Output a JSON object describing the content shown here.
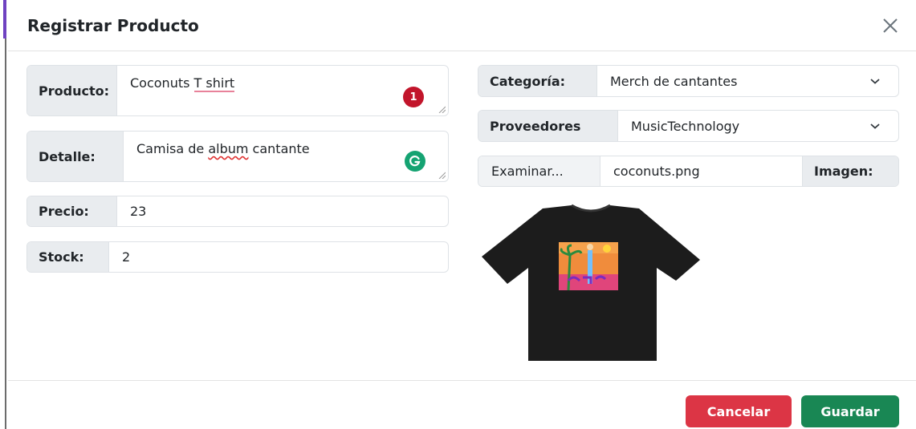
{
  "modal": {
    "title": "Registrar Producto"
  },
  "form": {
    "producto": {
      "label": "Producto:",
      "value": "Coconuts T shirt",
      "value_plain": "Coconuts ",
      "value_marked": "T shirt",
      "badge_count": "1"
    },
    "detalle": {
      "label": "Detalle:",
      "value_pre": "Camisa de ",
      "value_marked": "album",
      "value_post": " cantante"
    },
    "precio": {
      "label": "Precio:",
      "value": "23"
    },
    "stock": {
      "label": "Stock:",
      "value": "2"
    },
    "categoria": {
      "label": "Categoría:",
      "selected": "Merch de cantantes"
    },
    "proveedores": {
      "label": "Proveedores",
      "selected": "MusicTechnology"
    },
    "imagen": {
      "browse_label": "Examinar...",
      "file_name": "coconuts.png",
      "label": "Imagen:"
    }
  },
  "footer": {
    "cancel_label": "Cancelar",
    "save_label": "Guardar"
  },
  "icons": {
    "close": "close-icon",
    "dropdown": "chevron-down-icon",
    "grammarly": "grammarly-icon",
    "spelling_badge": "spelling-badge-icon"
  },
  "colors": {
    "cancel": "#dc3545",
    "save": "#198754",
    "addon_bg": "#e9ecef"
  }
}
